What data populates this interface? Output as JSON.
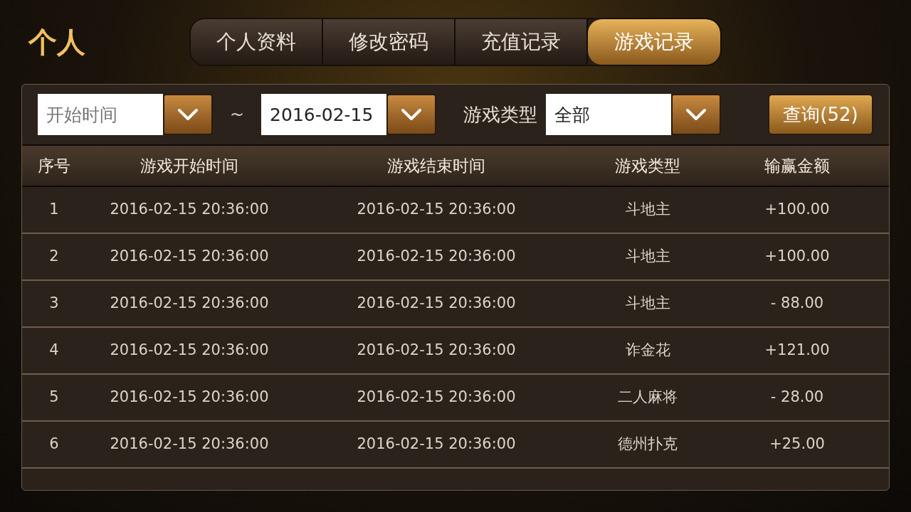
{
  "title": "个人",
  "tabs": [
    {
      "label": "个人资料",
      "selected": false
    },
    {
      "label": "修改密码",
      "selected": false
    },
    {
      "label": "充值记录",
      "selected": false
    },
    {
      "label": "游戏记录",
      "selected": true
    }
  ],
  "filters": {
    "start_date": {
      "placeholder": "开始时间"
    },
    "separator": "~",
    "end_date": {
      "value": "2016-02-15"
    },
    "game_type_label": "游戏类型",
    "game_type": {
      "value": "全部"
    },
    "query_button": "查询(52)"
  },
  "table": {
    "columns": [
      "序号",
      "游戏开始时间",
      "游戏结束时间",
      "游戏类型",
      "输赢金额"
    ],
    "rows": [
      [
        "1",
        "2016-02-15 20:36:00",
        "2016-02-15 20:36:00",
        "斗地主",
        "+100.00"
      ],
      [
        "2",
        "2016-02-15 20:36:00",
        "2016-02-15 20:36:00",
        "斗地主",
        "+100.00"
      ],
      [
        "3",
        "2016-02-15 20:36:00",
        "2016-02-15 20:36:00",
        "斗地主",
        "- 88.00"
      ],
      [
        "4",
        "2016-02-15 20:36:00",
        "2016-02-15 20:36:00",
        "诈金花",
        "+121.00"
      ],
      [
        "5",
        "2016-02-15 20:36:00",
        "2016-02-15 20:36:00",
        "二人麻将",
        "- 28.00"
      ],
      [
        "6",
        "2016-02-15 20:36:00",
        "2016-02-15 20:36:00",
        "德州扑克",
        "+25.00"
      ]
    ]
  }
}
